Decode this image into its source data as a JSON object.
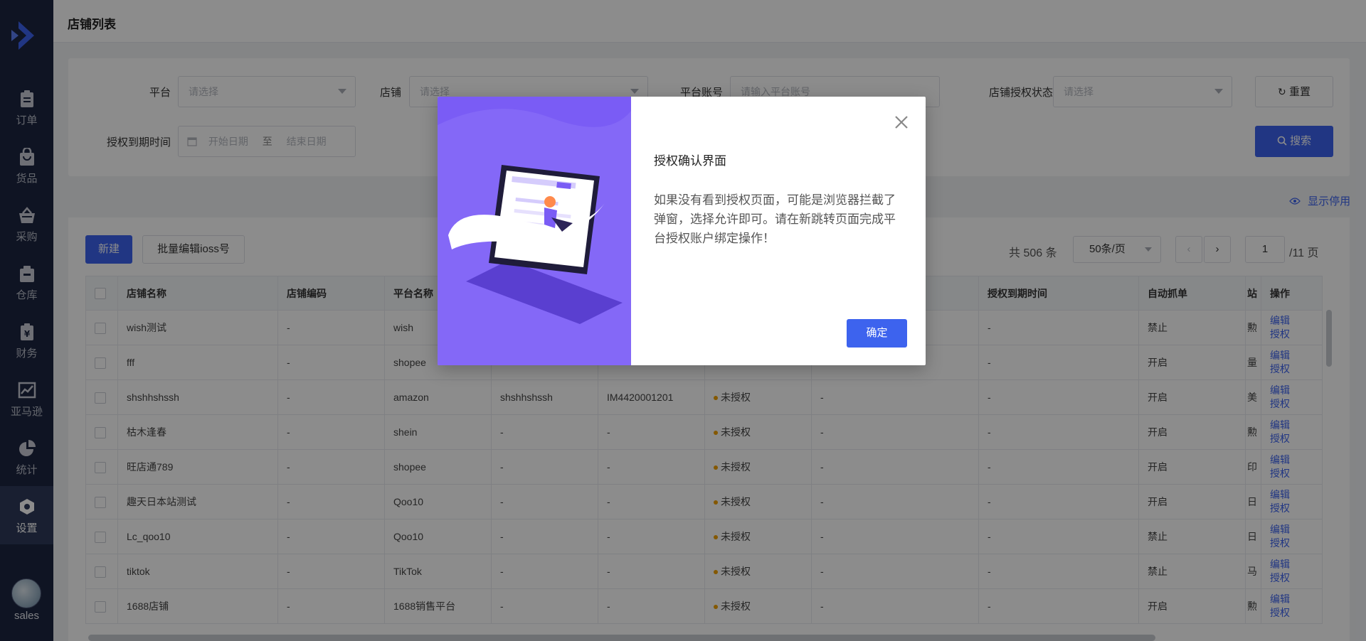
{
  "app": {
    "brand_color": "#3d63ee",
    "sidebar_bg": "#1d2540"
  },
  "sidebar": {
    "items": [
      {
        "label": "订单",
        "icon": "clipboard-icon"
      },
      {
        "label": "货品",
        "icon": "shopping-bag-icon"
      },
      {
        "label": "采购",
        "icon": "basket-icon"
      },
      {
        "label": "仓库",
        "icon": "warehouse-icon"
      },
      {
        "label": "财务",
        "icon": "yen-icon"
      },
      {
        "label": "亚马逊",
        "icon": "trend-chart-icon"
      },
      {
        "label": "统计",
        "icon": "pie-chart-icon"
      },
      {
        "label": "设置",
        "icon": "hexagon-gear-icon",
        "active": true
      }
    ],
    "user": {
      "name": "sales"
    }
  },
  "header": {
    "title": "店铺列表"
  },
  "filters": {
    "platform_label": "平台",
    "platform_placeholder": "请选择",
    "shop_label": "店铺",
    "shop_placeholder": "请选择",
    "account_label": "平台账号",
    "account_placeholder": "请输入平台账号",
    "auth_status_label": "店铺授权状态",
    "auth_status_placeholder": "请选择",
    "expire_label": "授权到期时间",
    "start_placeholder": "开始日期",
    "range_sep": "至",
    "end_placeholder": "结束日期",
    "reset_label": "重置",
    "search_label": "搜索"
  },
  "show_disabled_label": "显示停用",
  "toolbar": {
    "new_label": "新建",
    "batch_ioss_label": "批量编辑ioss号"
  },
  "pager": {
    "total": "共 506 条",
    "page_size": "50条/页",
    "current_page": "1",
    "total_pages": "/11 页"
  },
  "table": {
    "columns": [
      "店铺名称",
      "店铺编码",
      "平台名称",
      "",
      "",
      "",
      "",
      "授权到期时间",
      "自动抓单",
      "站",
      "操作"
    ],
    "rows": [
      {
        "name": "wish测试",
        "code": "-",
        "platform": "wish",
        "c4": "",
        "c5": "",
        "status": "",
        "c7": "",
        "expire": "-",
        "auto": "禁止",
        "site": "勲"
      },
      {
        "name": "fff",
        "code": "-",
        "platform": "shopee",
        "c4": "",
        "c5": "",
        "status": "",
        "c7": "",
        "expire": "-",
        "auto": "开启",
        "site": "量"
      },
      {
        "name": "shshhshssh",
        "code": "-",
        "platform": "amazon",
        "c4": "shshhshssh",
        "c5": "IM4420001201",
        "status": "未授权",
        "c7": "-",
        "expire": "-",
        "auto": "开启",
        "site": "美"
      },
      {
        "name": "枯木逢春",
        "code": "-",
        "platform": "shein",
        "c4": "-",
        "c5": "-",
        "status": "未授权",
        "c7": "-",
        "expire": "-",
        "auto": "开启",
        "site": "勲"
      },
      {
        "name": "旺店通789",
        "code": "-",
        "platform": "shopee",
        "c4": "-",
        "c5": "-",
        "status": "未授权",
        "c7": "-",
        "expire": "-",
        "auto": "开启",
        "site": "印"
      },
      {
        "name": "趣天日本站测试",
        "code": "-",
        "platform": "Qoo10",
        "c4": "-",
        "c5": "-",
        "status": "未授权",
        "c7": "-",
        "expire": "-",
        "auto": "开启",
        "site": "日"
      },
      {
        "name": "Lc_qoo10",
        "code": "-",
        "platform": "Qoo10",
        "c4": "-",
        "c5": "-",
        "status": "未授权",
        "c7": "-",
        "expire": "-",
        "auto": "禁止",
        "site": "日"
      },
      {
        "name": "tiktok",
        "code": "-",
        "platform": "TikTok",
        "c4": "-",
        "c5": "-",
        "status": "未授权",
        "c7": "-",
        "expire": "-",
        "auto": "禁止",
        "site": "马"
      },
      {
        "name": "1688店铺",
        "code": "-",
        "platform": "1688销售平台",
        "c4": "-",
        "c5": "-",
        "status": "未授权",
        "c7": "-",
        "expire": "-",
        "auto": "开启",
        "site": "勲"
      }
    ],
    "edit_label": "编辑",
    "auth_label": "授权"
  },
  "modal": {
    "title": "授权确认界面",
    "body": "如果没有看到授权页面，可能是浏览器拦截了弹窗，选择允许即可。请在新跳转页面完成平台授权账户绑定操作！",
    "ok_label": "确定",
    "illustration_bg": "#7a5cf5"
  }
}
